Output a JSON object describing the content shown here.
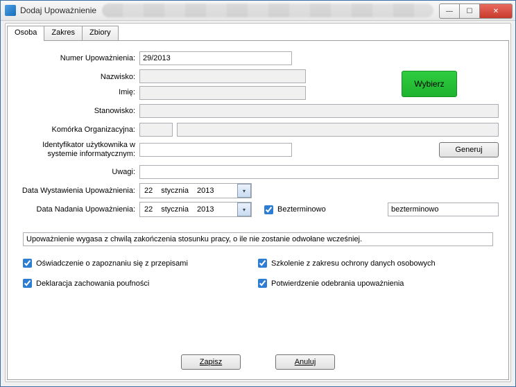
{
  "window": {
    "title": "Dodaj Upoważnienie"
  },
  "tabs": [
    "Osoba",
    "Zakres",
    "Zbiory"
  ],
  "activeTab": 0,
  "labels": {
    "numer": "Numer Upoważnienia:",
    "nazwisko": "Nazwisko:",
    "imie": "Imię:",
    "stanowisko": "Stanowisko:",
    "komorka": "Komórka Organizacyjna:",
    "ident": "Identyfikator użytkownika w systemie informatycznym:",
    "uwagi": "Uwagi:",
    "dataWyst": "Data Wystawienia Upoważnienia:",
    "dataNad": "Data Nadania Upoważnienia:"
  },
  "values": {
    "numer": "29/2013",
    "nazwisko": "",
    "imie": "",
    "stanowisko": "",
    "komorkaKod": "",
    "komorkaNazwa": "",
    "ident": "",
    "uwagi": "",
    "dataWyst": {
      "d": "22",
      "m": "stycznia",
      "y": "2013"
    },
    "dataNad": {
      "d": "22",
      "m": "stycznia",
      "y": "2013"
    },
    "bezterminowo": true,
    "bezterminowoText": "bezterminowo",
    "note": "Upoważnienie wygasa z chwilą zakończenia stosunku pracy, o ile nie zostanie odwołane wcześniej."
  },
  "buttons": {
    "wybierz": "Wybierz",
    "generuj": "Generuj",
    "zapisz": "Zapisz",
    "anuluj": "Anuluj"
  },
  "checkLabels": {
    "bezterminowo": "Bezterminowo",
    "oswiadczenie": "Oświadczenie o zapoznaniu się z przepisami",
    "szkolenie": "Szkolenie z zakresu ochrony danych osobowych",
    "deklaracja": "Deklaracja zachowania poufności",
    "potwierdzenie": "Potwierdzenie odebrania upoważnienia"
  },
  "checks": {
    "oswiadczenie": true,
    "szkolenie": true,
    "deklaracja": true,
    "potwierdzenie": true
  }
}
